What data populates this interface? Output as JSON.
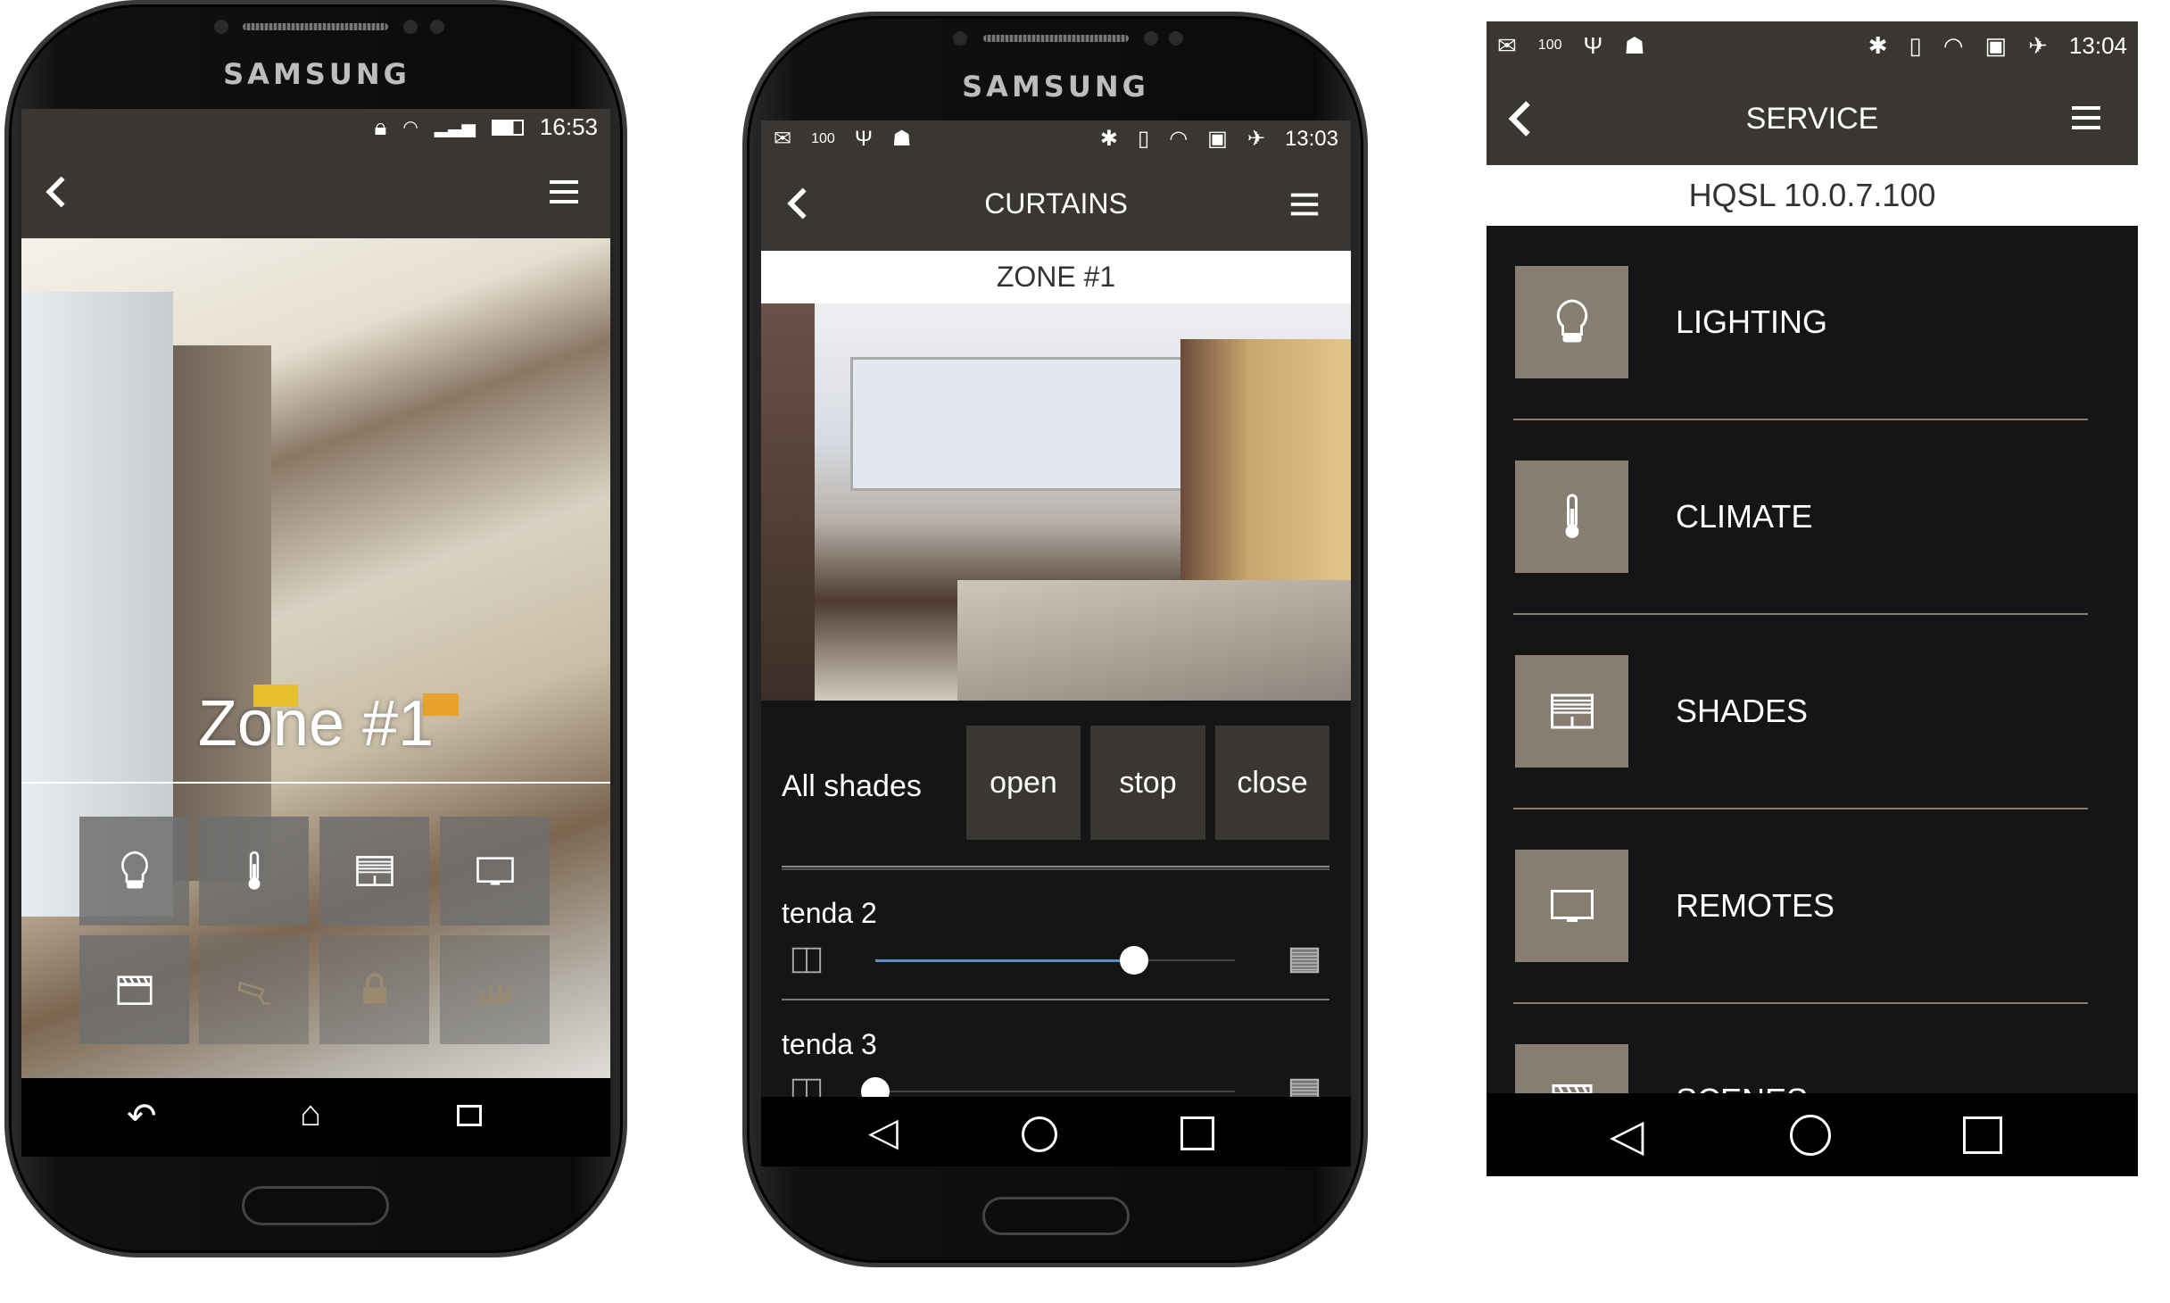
{
  "phone1": {
    "brand": "SAMSUNG",
    "status_time": "16:53",
    "zone_title": "Zone #1",
    "tiles": [
      {
        "icon": "lightbulb-icon",
        "enabled": true
      },
      {
        "icon": "thermometer-icon",
        "enabled": true
      },
      {
        "icon": "shades-icon",
        "enabled": true
      },
      {
        "icon": "tv-icon",
        "enabled": true
      },
      {
        "icon": "clapperboard-icon",
        "enabled": true
      },
      {
        "icon": "camera-icon",
        "enabled": false
      },
      {
        "icon": "lock-icon",
        "enabled": false
      },
      {
        "icon": "equalizer-icon",
        "enabled": false
      }
    ]
  },
  "phone2": {
    "brand": "SAMSUNG",
    "status_time": "13:03",
    "title": "CURTAINS",
    "zone": "ZONE #1",
    "all_shades_label": "All shades",
    "buttons": {
      "open": "open",
      "stop": "stop",
      "close": "close"
    },
    "shades": [
      {
        "name": "tenda 2",
        "position": 0.72
      },
      {
        "name": "tenda 3",
        "position": 0.0
      }
    ],
    "slider_color": "#5b8fc7"
  },
  "panel3": {
    "status_time": "13:04",
    "title": "SERVICE",
    "host": "HQSL 10.0.7.100",
    "items": [
      {
        "label": "LIGHTING",
        "icon": "lightbulb-icon"
      },
      {
        "label": "CLIMATE",
        "icon": "thermometer-icon"
      },
      {
        "label": "SHADES",
        "icon": "shades-icon"
      },
      {
        "label": "REMOTES",
        "icon": "tv-icon"
      },
      {
        "label": "SCENES",
        "icon": "clapperboard-icon"
      }
    ],
    "accent": "#877e71"
  }
}
